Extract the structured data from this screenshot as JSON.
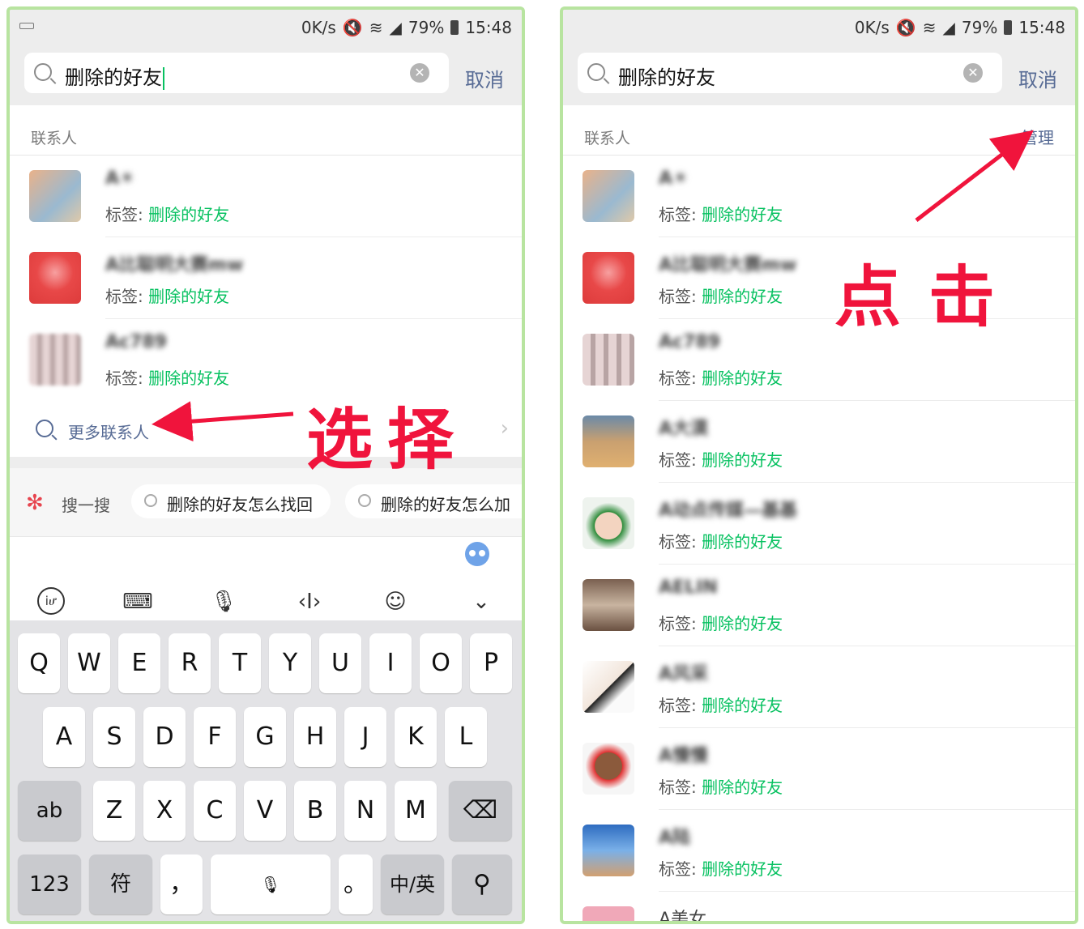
{
  "status": {
    "speed": "0K/s",
    "battery": "79%",
    "time": "15:48"
  },
  "search": {
    "query": "删除的好友",
    "clear_icon": "clear-icon",
    "cancel": "取消"
  },
  "section": {
    "label": "联系人",
    "manage": "管理"
  },
  "tag_prefix": "标签:",
  "tag_value": "删除的好友",
  "left_contacts": [
    {
      "name": "A☀"
    },
    {
      "name": "A比聪明大赛mw"
    },
    {
      "name": "Ac789"
    }
  ],
  "right_contacts": [
    {
      "name": "A☀"
    },
    {
      "name": "A比聪明大赛mw"
    },
    {
      "name": "Ac789"
    },
    {
      "name": "A大漠"
    },
    {
      "name": "A动点传媒—基基"
    },
    {
      "name": "AELIN"
    },
    {
      "name": "A风采"
    },
    {
      "name": "A慢慢"
    },
    {
      "name": "A陆"
    }
  ],
  "partial_contact": "A美女",
  "more_contacts": "更多联系人",
  "sosou": {
    "label": "搜一搜",
    "suggestions": [
      "删除的好友怎么找回",
      "删除的好友怎么加"
    ]
  },
  "keyboard": {
    "row1": [
      "Q",
      "W",
      "E",
      "R",
      "T",
      "Y",
      "U",
      "I",
      "O",
      "P"
    ],
    "row2": [
      "A",
      "S",
      "D",
      "F",
      "G",
      "H",
      "J",
      "K",
      "L"
    ],
    "row3": [
      "Z",
      "X",
      "C",
      "V",
      "B",
      "N",
      "M"
    ],
    "ab": "ab",
    "num": "123",
    "sym": "符",
    "comma": "，",
    "period": "。",
    "lang": "中/英"
  },
  "annotations": {
    "select": "选择",
    "click": "点击"
  },
  "colors": {
    "accent_green": "#07c160",
    "link_blue": "#576b95",
    "annotation_red": "#f0143c",
    "frame": "#b8e4a0"
  }
}
